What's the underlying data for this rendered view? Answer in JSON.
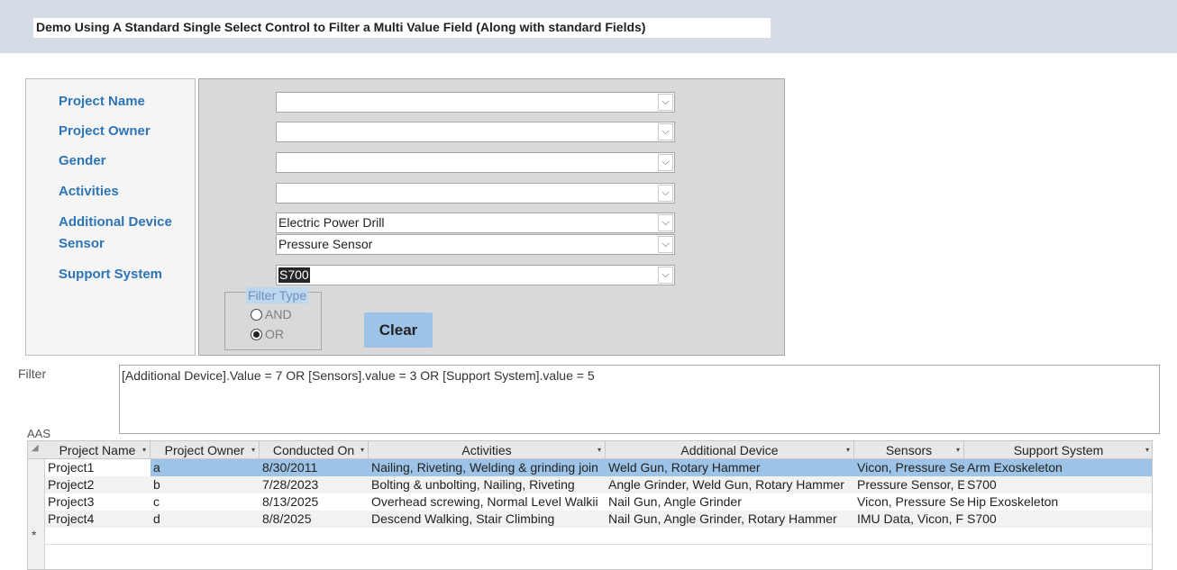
{
  "header": {
    "title": "Demo Using A Standard Single Select Control to Filter a Multi Value Field (Along with standard Fields)"
  },
  "form": {
    "labels": {
      "project_name": "Project Name",
      "project_owner": "Project Owner",
      "gender": "Gender",
      "activities": "Activities",
      "additional_device": "Additional Device",
      "sensor": "Sensor",
      "support_system": "Support System"
    },
    "combos": {
      "project_name": "",
      "project_owner": "",
      "gender": "",
      "activities": "",
      "additional_device": "Electric Power Drill",
      "sensor": "Pressure Sensor",
      "support_system": "S700"
    },
    "filter_type": {
      "legend": "Filter Type",
      "options": [
        "AND",
        "OR"
      ],
      "selected": "OR"
    },
    "clear_label": "Clear"
  },
  "filter": {
    "label": "Filter",
    "text": "[Additional Device].Value = 7 OR [Sensors].value = 3 OR [Support System].value = 5"
  },
  "datasheet": {
    "caption": "AAS",
    "columns": [
      "Project Name",
      "Project Owner",
      "Conducted On",
      "Activities",
      "Additional Device",
      "Sensors",
      "Support System"
    ],
    "rows": [
      [
        "Project1",
        "a",
        "8/30/2011",
        "Nailing, Riveting, Welding & grinding join",
        "Weld Gun, Rotary Hammer",
        "Vicon, Pressure Se",
        "Arm Exoskeleton"
      ],
      [
        "Project2",
        "b",
        "7/28/2023",
        "Bolting & unbolting, Nailing, Riveting",
        "Angle Grinder, Weld Gun, Rotary Hammer",
        "Pressure Sensor, E",
        "S700"
      ],
      [
        "Project3",
        "c",
        "8/13/2025",
        "Overhead screwing, Normal Level Walkii",
        "Nail Gun, Angle Grinder",
        "Vicon, Pressure Se",
        "Hip Exoskeleton"
      ],
      [
        "Project4",
        "d",
        "8/8/2025",
        "Descend Walking, Stair Climbing",
        "Nail Gun, Angle Grinder, Rotary Hammer",
        "IMU Data, Vicon, F",
        "S700"
      ]
    ],
    "new_row_marker": "*",
    "icons": {
      "combo_dropdown": "chevron-down-icon",
      "column_sort": "sort-arrow-icon",
      "select_all": "select-all-triangle-icon"
    }
  }
}
